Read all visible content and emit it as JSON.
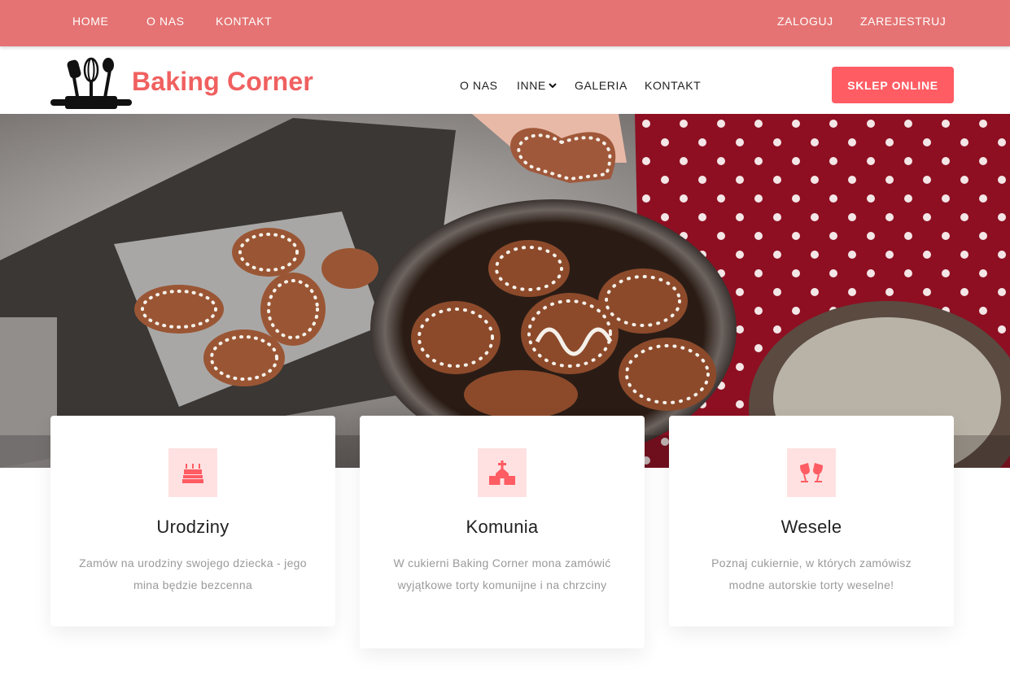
{
  "topbar": {
    "left_links": [
      "HOME",
      "O NAS",
      "KONTAKT"
    ],
    "right_links": [
      "ZALOGUJ",
      "ZAREJESTRUJ"
    ]
  },
  "header": {
    "brand": "Baking Corner",
    "nav": [
      "O NAS",
      "INNE",
      "GALERIA",
      "KONTAKT"
    ],
    "shop_button": "SKLEP ONLINE"
  },
  "cards": [
    {
      "icon": "birthday-cake-icon",
      "title": "Urodziny",
      "text": "Zamów na urodziny swojego dziecka - jego mina będzie bezcenna"
    },
    {
      "icon": "church-icon",
      "title": "Komunia",
      "text": "W cukierni Baking Corner mona zamówić wyjątkowe torty komunijne i na chrzciny"
    },
    {
      "icon": "wedding-glasses-icon",
      "title": "Wesele",
      "text": "Poznaj cukiernie, w których zamówisz modne autorskie torty weselne!"
    }
  ],
  "colors": {
    "topbar": "#e57373",
    "brand": "#f06060",
    "button": "#ff5c63",
    "icon_bg": "#ffe1e1"
  }
}
